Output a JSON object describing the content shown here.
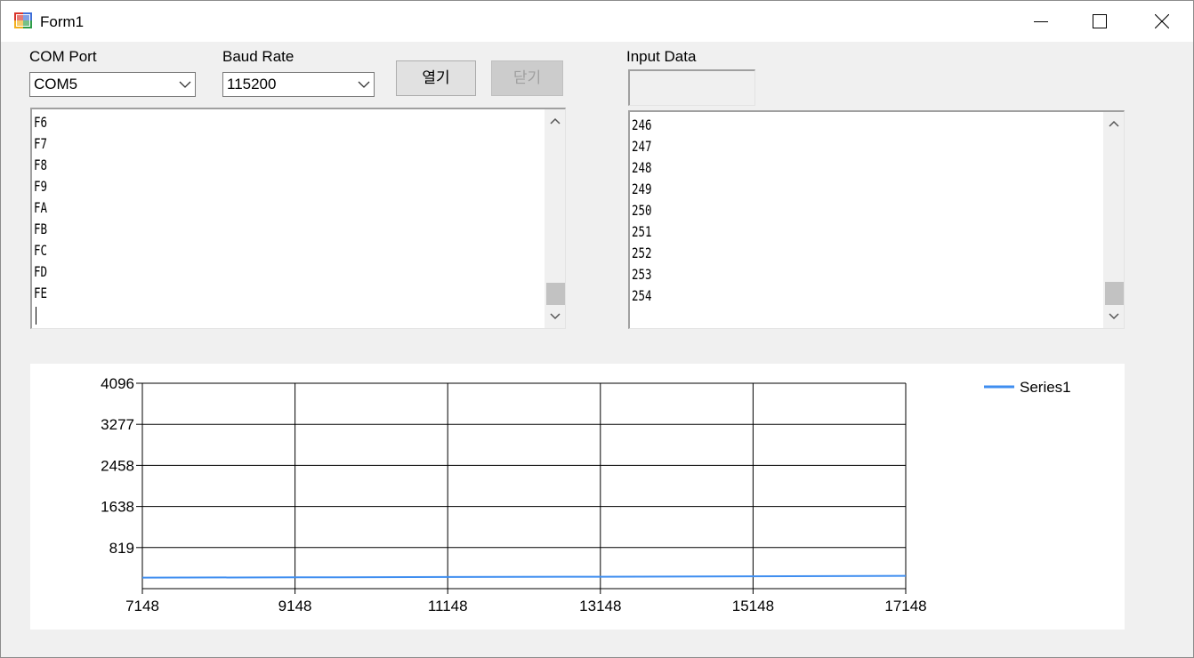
{
  "window": {
    "title": "Form1",
    "icons": {
      "app": "form-app-icon",
      "minimize": "minimize-icon",
      "maximize": "maximize-icon",
      "close": "close-icon"
    }
  },
  "serial": {
    "com_port_label": "COM Port",
    "com_port_value": "COM5",
    "baud_rate_label": "Baud Rate",
    "baud_rate_value": "115200",
    "open_button": "열기",
    "close_button": "닫기"
  },
  "hex_log": {
    "lines": [
      "F6",
      "F7",
      "F8",
      "F9",
      "FA",
      "FB",
      "FC",
      "FD",
      "FE"
    ]
  },
  "input": {
    "label": "Input Data",
    "value": "",
    "lines": [
      "246",
      "247",
      "248",
      "249",
      "250",
      "251",
      "252",
      "253",
      "254"
    ]
  },
  "chart_data": {
    "type": "line",
    "xlim": [
      7148,
      17148
    ],
    "ylim": [
      0,
      4096
    ],
    "x_ticks": [
      7148,
      9148,
      11148,
      13148,
      15148,
      17148
    ],
    "y_ticks": [
      819,
      1638,
      2458,
      3277,
      4096
    ],
    "x_tick_labels": [
      "7148",
      "9148",
      "11148",
      "13148",
      "15148",
      "17148"
    ],
    "y_tick_labels": [
      "819",
      "1638",
      "2458",
      "3277",
      "4096"
    ],
    "grid": true,
    "legend_position": "top-right",
    "series": [
      {
        "name": "Series1",
        "color": "#3f8ef0",
        "x": [
          7148,
          9148,
          11148,
          13148,
          15148,
          17148
        ],
        "y": [
          220,
          225,
          232,
          238,
          246,
          254
        ]
      }
    ]
  }
}
